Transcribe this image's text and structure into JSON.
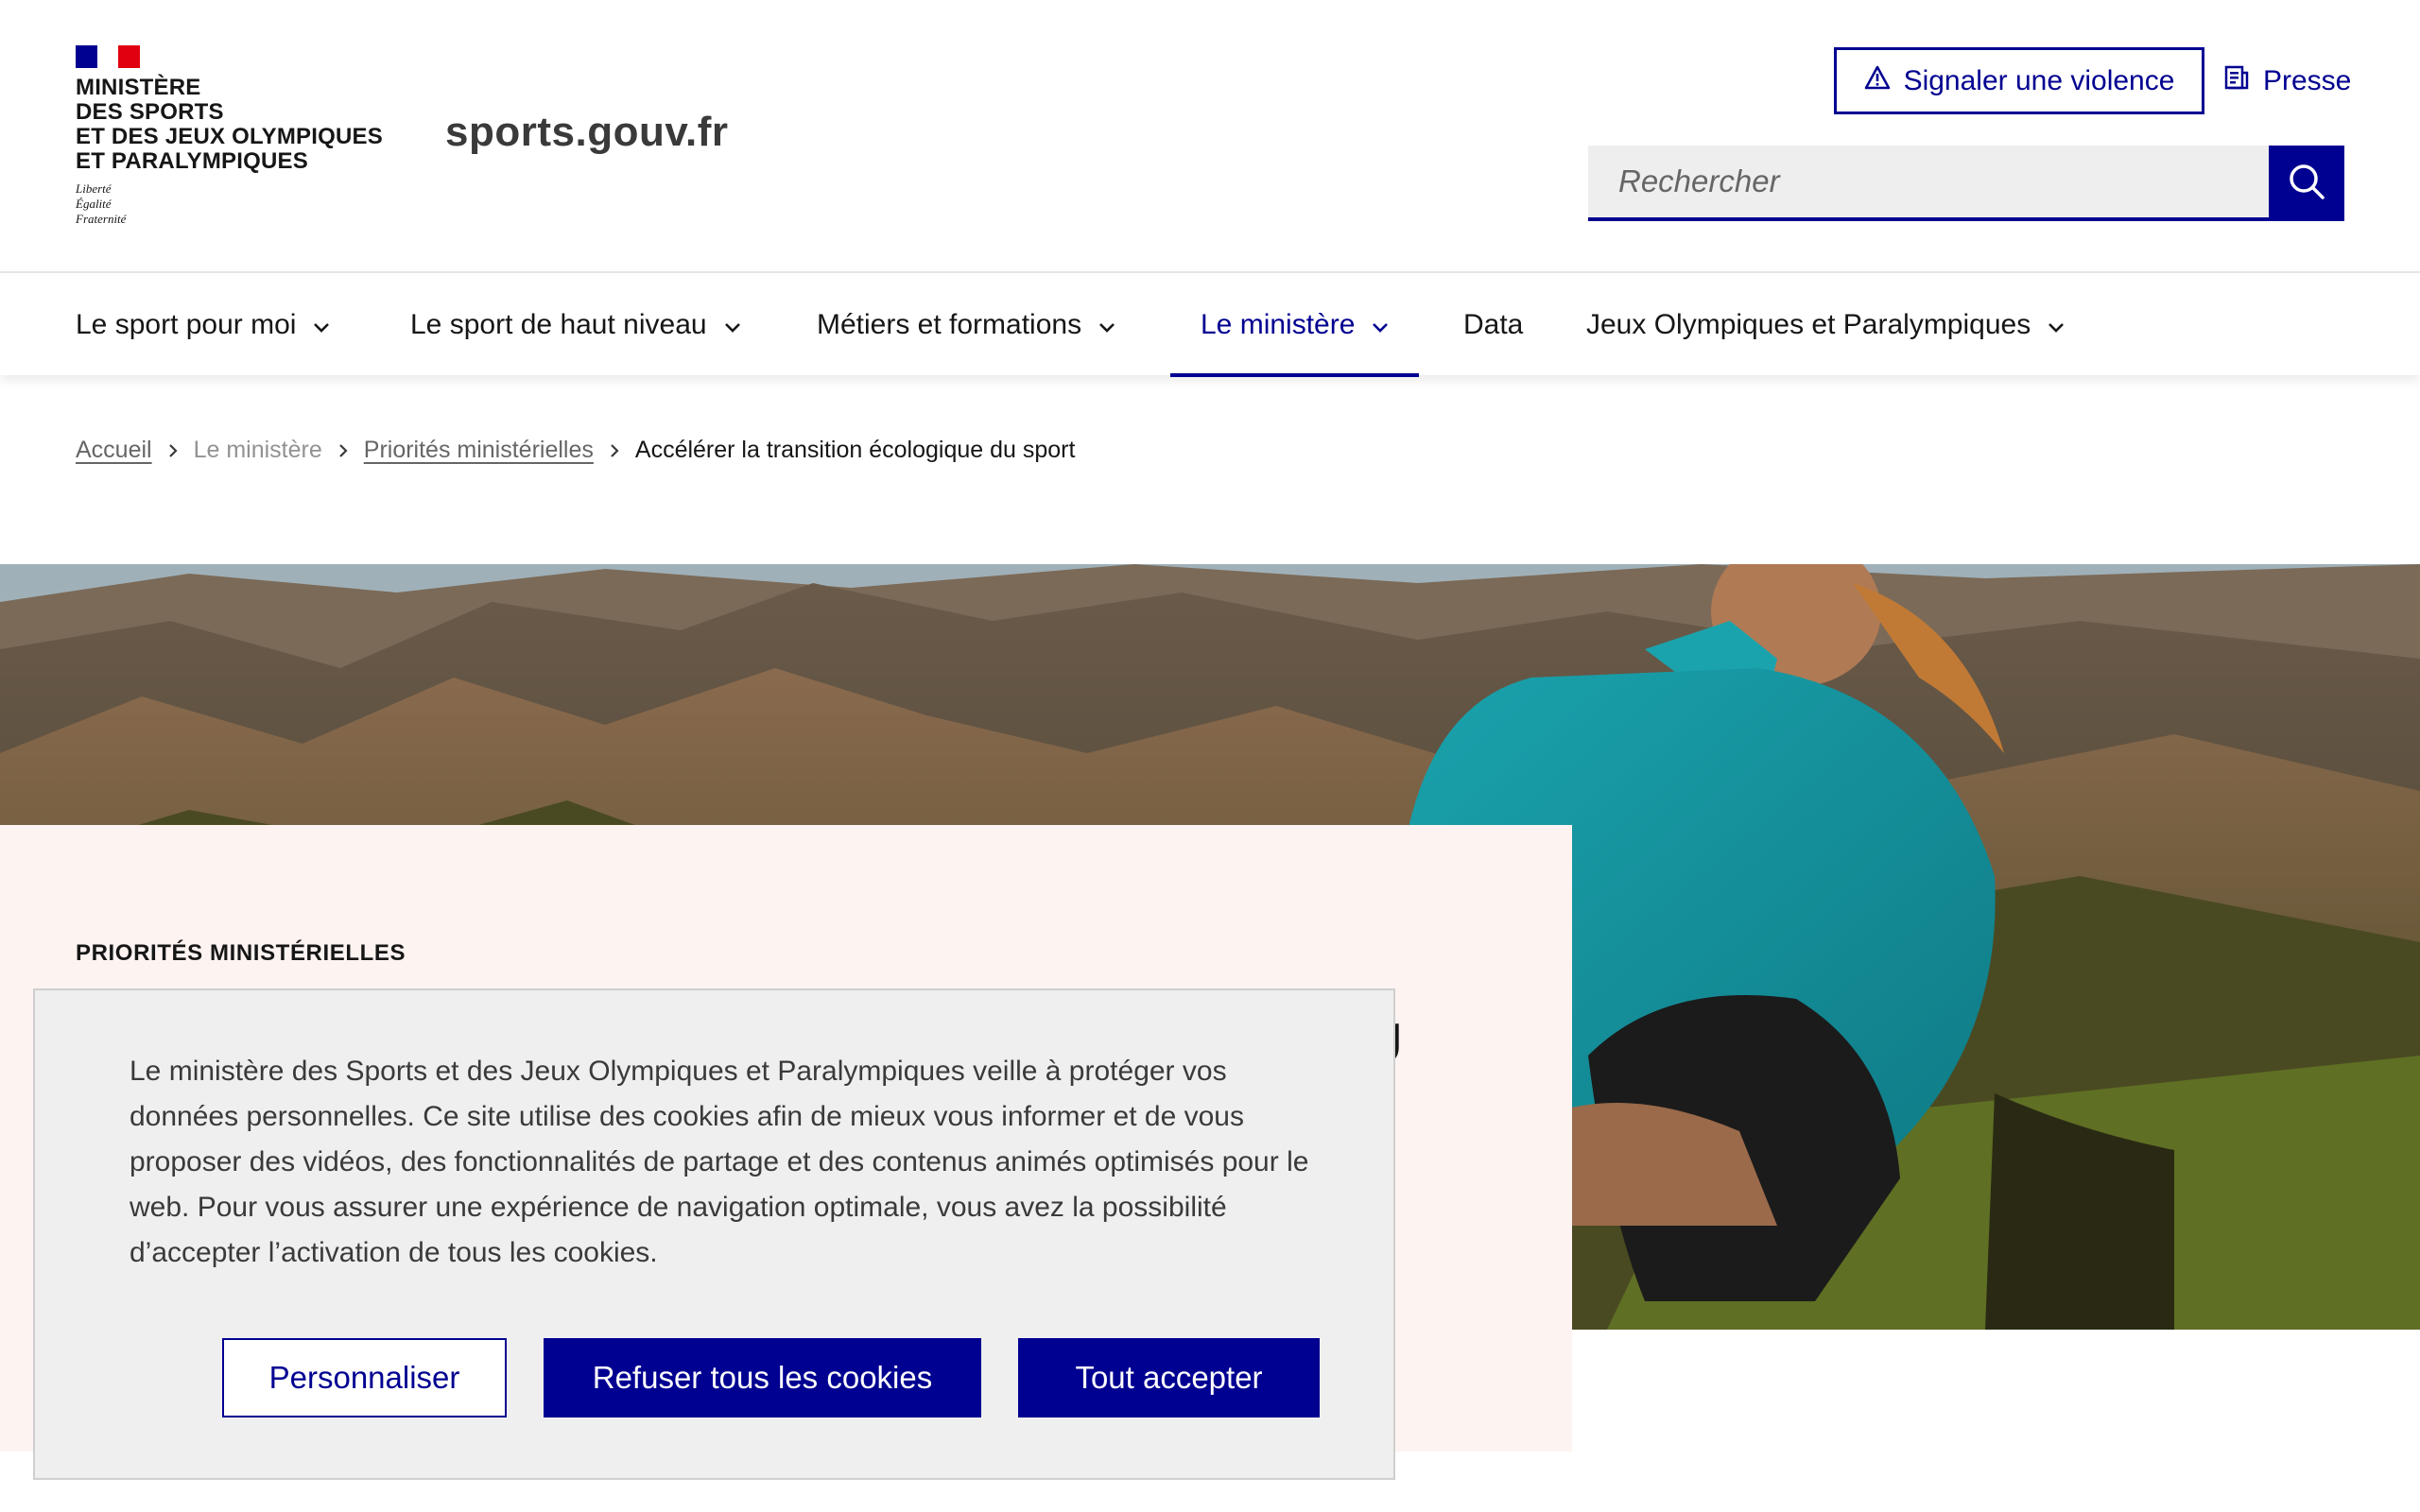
{
  "header": {
    "ministry_lines": [
      "MINISTÈRE",
      "DES SPORTS",
      "ET DES JEUX OLYMPIQUES",
      "ET PARALYMPIQUES"
    ],
    "devise": [
      "Liberté",
      "Égalité",
      "Fraternité"
    ],
    "site_name": "sports.gouv.fr",
    "violence_button": "Signaler une violence",
    "presse_link": "Presse",
    "search_placeholder": "Rechercher",
    "flag_colors": [
      "#000091",
      "#ffffff",
      "#e1000f"
    ]
  },
  "nav": {
    "items": [
      {
        "label": "Le sport pour moi"
      },
      {
        "label": "Le sport de haut niveau"
      },
      {
        "label": "Métiers et formations"
      },
      {
        "label": "Le ministère"
      },
      {
        "label": "Data"
      },
      {
        "label": "Jeux Olympiques et Paralympiques"
      }
    ],
    "active": "Le ministère"
  },
  "breadcrumb": {
    "items": [
      "Accueil",
      "Le ministère",
      "Priorités ministérielles",
      "Accélérer la transition écologique du sport"
    ]
  },
  "hero": {
    "kicker": "PRIORITÉS MINISTÉRIELLES",
    "title_visible_fragment": "U"
  },
  "cookie_banner": {
    "text": "Le ministère des Sports et des Jeux Olympiques et Paralympiques veille à protéger vos données personnelles. Ce site utilise des cookies afin de mieux vous informer et de vous proposer des vidéos, des fonctionnalités de partage et des contenus animés optimisés pour le web. Pour vous assurer une expérience de navigation optimale, vous avez la possibilité d’accepter l’activation de tous les cookies.",
    "personalize_label": "Personnaliser",
    "refuse_label": "Refuser tous les cookies",
    "accept_label": "Tout accepter"
  },
  "colors": {
    "primary": "#000091",
    "hero_panel": "#fdf3f1",
    "cookie_bg": "#efefef"
  }
}
